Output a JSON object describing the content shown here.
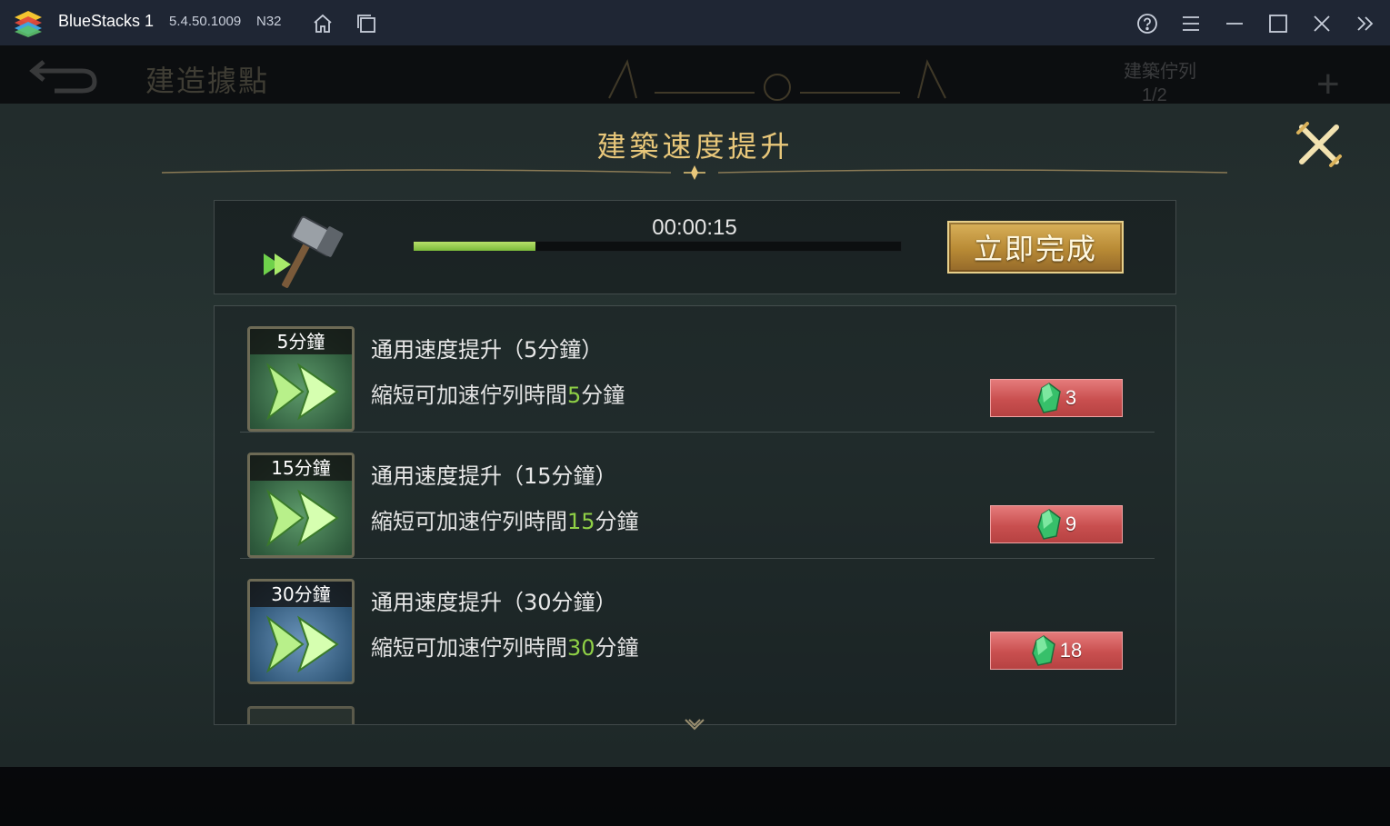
{
  "titlebar": {
    "app_name": "BlueStacks 1",
    "version": "5.4.50.1009",
    "build": "N32",
    "icons": [
      "bluestacks-logo",
      "home-icon",
      "multi-instance-icon",
      "help-icon",
      "menu-icon",
      "minimize-icon",
      "maximize-icon",
      "close-icon",
      "expand-sidebar-icon"
    ]
  },
  "game_header": {
    "title": "建造據點",
    "queue_label": "建築佇列",
    "queue_count": "1/2"
  },
  "modal": {
    "title": "建築速度提升",
    "progress": {
      "timer": "00:00:15",
      "fraction": 0.25,
      "finish_label": "立即完成"
    },
    "items": [
      {
        "icon_label": "5分鐘",
        "icon_color": "green",
        "name": "通用速度提升（5分鐘）",
        "desc_prefix": "縮短可加速佇列時間",
        "desc_value": "5",
        "desc_suffix": "分鐘",
        "cost": "3"
      },
      {
        "icon_label": "15分鐘",
        "icon_color": "green",
        "name": "通用速度提升（15分鐘）",
        "desc_prefix": "縮短可加速佇列時間",
        "desc_value": "15",
        "desc_suffix": "分鐘",
        "cost": "9"
      },
      {
        "icon_label": "30分鐘",
        "icon_color": "blue",
        "name": "通用速度提升（30分鐘）",
        "desc_prefix": "縮短可加速佇列時間",
        "desc_value": "30",
        "desc_suffix": "分鐘",
        "cost": "18"
      }
    ]
  },
  "colors": {
    "titlebar_bg": "#1f2634",
    "title_gold": "#e8c77a",
    "progress_green": "#8fd046",
    "gem_button_red": "#c94f4f",
    "finish_button_gold": "#d9b15a"
  }
}
